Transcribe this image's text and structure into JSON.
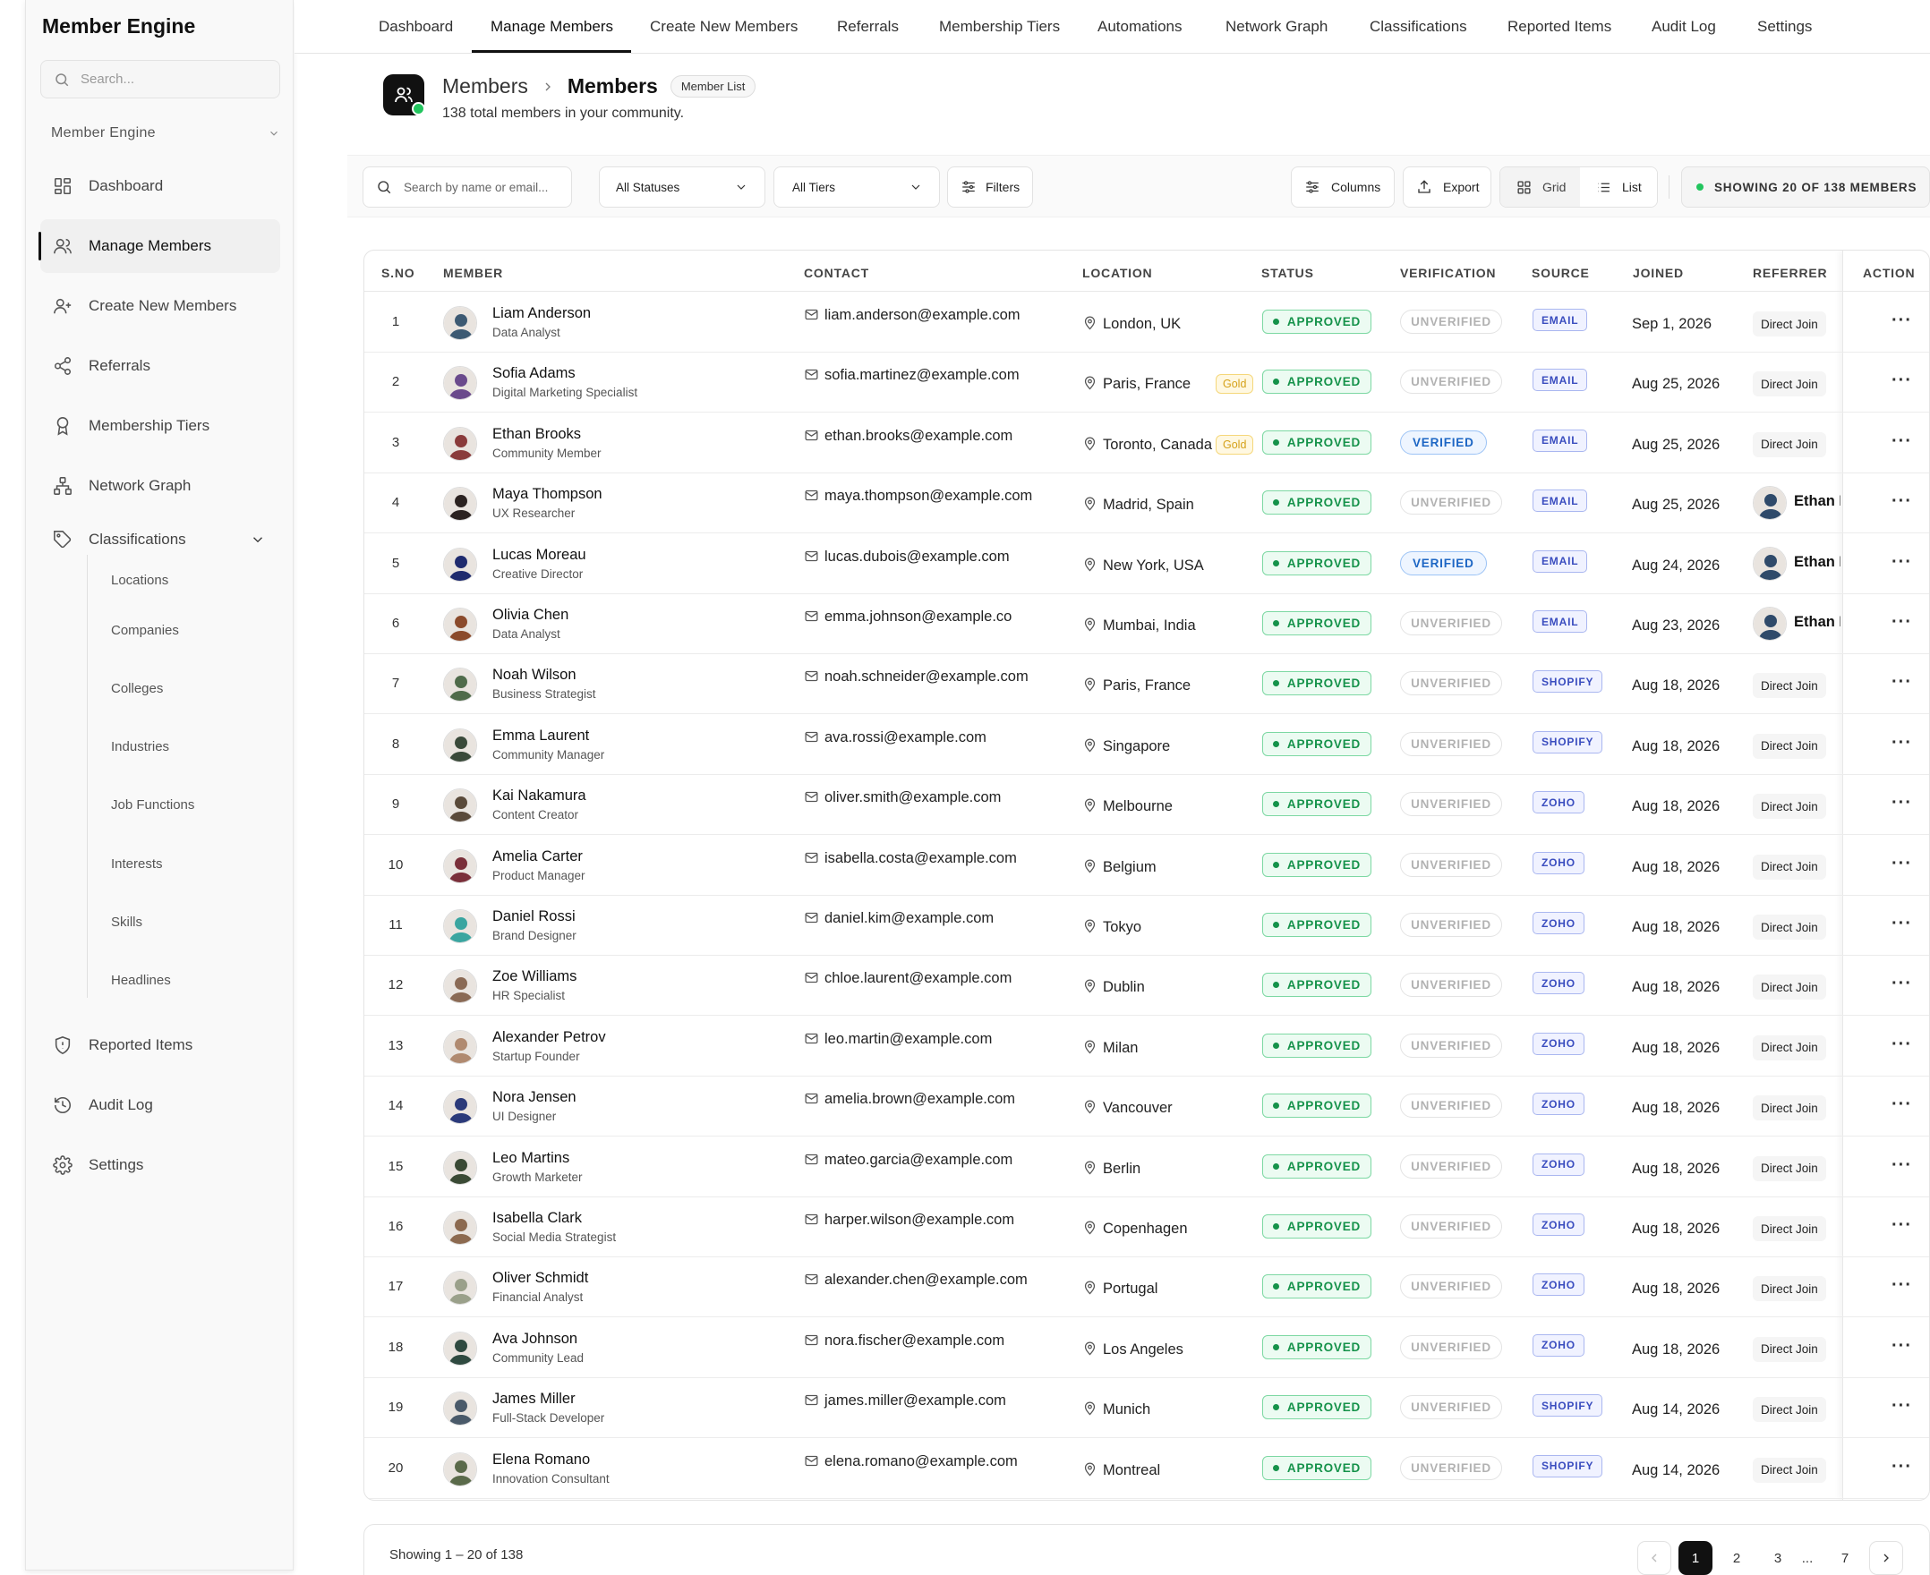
{
  "sidebar": {
    "brand": "Member Engine",
    "search_placeholder": "Search...",
    "workspace": "Member Engine",
    "items": [
      {
        "label": "Dashboard"
      },
      {
        "label": "Manage Members"
      },
      {
        "label": "Create New Members"
      },
      {
        "label": "Referrals"
      },
      {
        "label": "Membership Tiers"
      },
      {
        "label": "Network Graph"
      },
      {
        "label": "Classifications"
      },
      {
        "label": "Reported Items"
      },
      {
        "label": "Audit Log"
      },
      {
        "label": "Settings"
      }
    ],
    "subitems": [
      "Locations",
      "Companies",
      "Colleges",
      "Industries",
      "Job Functions",
      "Interests",
      "Skills",
      "Headlines"
    ]
  },
  "topnav": {
    "tabs": [
      "Dashboard",
      "Manage Members",
      "Create New Members",
      "Referrals",
      "Membership Tiers",
      "Automations",
      "Network Graph",
      "Classifications",
      "Reported Items",
      "Audit Log",
      "Settings"
    ],
    "active": "Manage Members"
  },
  "page": {
    "crumb_parent": "Members",
    "crumb_current": "Members",
    "badge": "Member List",
    "subtitle": "138 total members in your community."
  },
  "toolbar": {
    "search_placeholder": "Search by name or email...",
    "status_filter": "All Statuses",
    "tier_filter": "All Tiers",
    "filters": "Filters",
    "columns": "Columns",
    "export": "Export",
    "grid": "Grid",
    "list": "List",
    "count": "SHOWING 20 OF 138 MEMBERS"
  },
  "table": {
    "headers": [
      "S.NO",
      "MEMBER",
      "CONTACT",
      "LOCATION",
      "STATUS",
      "VERIFICATION",
      "SOURCE",
      "JOINED",
      "REFERRER",
      "ACTION"
    ],
    "rows": [
      {
        "sno": "1",
        "name": "Liam Anderson",
        "role": "Data Analyst",
        "email": "liam.anderson@example.com",
        "location": "London, UK",
        "tier": "",
        "status": "APPROVED",
        "verification": "UNVERIFIED",
        "source": "EMAIL",
        "joined": "Sep 1, 2026",
        "referrer": "Direct Join",
        "ref_avatar": false,
        "avatar_color": "#3d5a73"
      },
      {
        "sno": "2",
        "name": "Sofia Adams",
        "role": "Digital Marketing Specialist",
        "email": "sofia.martinez@example.com",
        "location": "Paris, France",
        "tier": "Gold",
        "status": "APPROVED",
        "verification": "UNVERIFIED",
        "source": "EMAIL",
        "joined": "Aug 25, 2026",
        "referrer": "Direct Join",
        "ref_avatar": false,
        "avatar_color": "#6a4a8c"
      },
      {
        "sno": "3",
        "name": "Ethan Brooks",
        "role": "Community Member",
        "email": "ethan.brooks@example.com",
        "location": "Toronto, Canada",
        "tier": "Gold",
        "status": "APPROVED",
        "verification": "VERIFIED",
        "source": "EMAIL",
        "joined": "Aug 25, 2026",
        "referrer": "Direct Join",
        "ref_avatar": false,
        "avatar_color": "#8a3b3b"
      },
      {
        "sno": "4",
        "name": "Maya Thompson",
        "role": "UX Researcher",
        "email": "maya.thompson@example.com",
        "location": "Madrid, Spain",
        "tier": "",
        "status": "APPROVED",
        "verification": "UNVERIFIED",
        "source": "EMAIL",
        "joined": "Aug 25, 2026",
        "referrer": "Ethan Brooks",
        "ref_avatar": true,
        "avatar_color": "#2b2220"
      },
      {
        "sno": "5",
        "name": "Lucas Moreau",
        "role": "Creative Director",
        "email": "lucas.dubois@example.com",
        "location": "New York, USA",
        "tier": "",
        "status": "APPROVED",
        "verification": "VERIFIED",
        "source": "EMAIL",
        "joined": "Aug 24, 2026",
        "referrer": "Ethan Brooks",
        "ref_avatar": true,
        "avatar_color": "#1f2b6e"
      },
      {
        "sno": "6",
        "name": "Olivia Chen",
        "role": "Data Analyst",
        "email": "emma.johnson@example.co",
        "location": "Mumbai, India",
        "tier": "",
        "status": "APPROVED",
        "verification": "UNVERIFIED",
        "source": "EMAIL",
        "joined": "Aug 23, 2026",
        "referrer": "Ethan Brooks",
        "ref_avatar": true,
        "avatar_color": "#8b4a2b"
      },
      {
        "sno": "7",
        "name": "Noah Wilson",
        "role": "Business Strategist",
        "email": "noah.schneider@example.com",
        "location": "Paris, France",
        "tier": "",
        "status": "APPROVED",
        "verification": "UNVERIFIED",
        "source": "SHOPIFY",
        "joined": "Aug 18, 2026",
        "referrer": "Direct Join",
        "ref_avatar": false,
        "avatar_color": "#4f6b4a"
      },
      {
        "sno": "8",
        "name": "Emma Laurent",
        "role": "Community Manager",
        "email": "ava.rossi@example.com",
        "location": "Singapore",
        "tier": "",
        "status": "APPROVED",
        "verification": "UNVERIFIED",
        "source": "SHOPIFY",
        "joined": "Aug 18, 2026",
        "referrer": "Direct Join",
        "ref_avatar": false,
        "avatar_color": "#3a4a3a"
      },
      {
        "sno": "9",
        "name": "Kai Nakamura",
        "role": "Content Creator",
        "email": "oliver.smith@example.com",
        "location": "Melbourne",
        "tier": "",
        "status": "APPROVED",
        "verification": "UNVERIFIED",
        "source": "ZOHO",
        "joined": "Aug 18, 2026",
        "referrer": "Direct Join",
        "ref_avatar": false,
        "avatar_color": "#5a4a3a"
      },
      {
        "sno": "10",
        "name": "Amelia Carter",
        "role": "Product Manager",
        "email": "isabella.costa@example.com",
        "location": "Belgium",
        "tier": "",
        "status": "APPROVED",
        "verification": "UNVERIFIED",
        "source": "ZOHO",
        "joined": "Aug 18, 2026",
        "referrer": "Direct Join",
        "ref_avatar": false,
        "avatar_color": "#7a2f3a"
      },
      {
        "sno": "11",
        "name": "Daniel Rossi",
        "role": "Brand Designer",
        "email": "daniel.kim@example.com",
        "location": "Tokyo",
        "tier": "",
        "status": "APPROVED",
        "verification": "UNVERIFIED",
        "source": "ZOHO",
        "joined": "Aug 18, 2026",
        "referrer": "Direct Join",
        "ref_avatar": false,
        "avatar_color": "#3aa5a0"
      },
      {
        "sno": "12",
        "name": "Zoe Williams",
        "role": "HR Specialist",
        "email": "chloe.laurent@example.com",
        "location": "Dublin",
        "tier": "",
        "status": "APPROVED",
        "verification": "UNVERIFIED",
        "source": "ZOHO",
        "joined": "Aug 18, 2026",
        "referrer": "Direct Join",
        "ref_avatar": false,
        "avatar_color": "#8a6a55"
      },
      {
        "sno": "13",
        "name": "Alexander Petrov",
        "role": "Startup Founder",
        "email": "leo.martin@example.com",
        "location": "Milan",
        "tier": "",
        "status": "APPROVED",
        "verification": "UNVERIFIED",
        "source": "ZOHO",
        "joined": "Aug 18, 2026",
        "referrer": "Direct Join",
        "ref_avatar": false,
        "avatar_color": "#b08a70"
      },
      {
        "sno": "14",
        "name": "Nora Jensen",
        "role": "UI Designer",
        "email": "amelia.brown@example.com",
        "location": "Vancouver",
        "tier": "",
        "status": "APPROVED",
        "verification": "UNVERIFIED",
        "source": "ZOHO",
        "joined": "Aug 18, 2026",
        "referrer": "Direct Join",
        "ref_avatar": false,
        "avatar_color": "#2b3a7a"
      },
      {
        "sno": "15",
        "name": "Leo Martins",
        "role": "Growth Marketer",
        "email": "mateo.garcia@example.com",
        "location": "Berlin",
        "tier": "",
        "status": "APPROVED",
        "verification": "UNVERIFIED",
        "source": "ZOHO",
        "joined": "Aug 18, 2026",
        "referrer": "Direct Join",
        "ref_avatar": false,
        "avatar_color": "#3a4a35"
      },
      {
        "sno": "16",
        "name": "Isabella Clark",
        "role": "Social Media Strategist",
        "email": "harper.wilson@example.com",
        "location": "Copenhagen",
        "tier": "",
        "status": "APPROVED",
        "verification": "UNVERIFIED",
        "source": "ZOHO",
        "joined": "Aug 18, 2026",
        "referrer": "Direct Join",
        "ref_avatar": false,
        "avatar_color": "#8c6a50"
      },
      {
        "sno": "17",
        "name": "Oliver Schmidt",
        "role": "Financial Analyst",
        "email": "alexander.chen@example.com",
        "location": "Portugal",
        "tier": "",
        "status": "APPROVED",
        "verification": "UNVERIFIED",
        "source": "ZOHO",
        "joined": "Aug 18, 2026",
        "referrer": "Direct Join",
        "ref_avatar": false,
        "avatar_color": "#9aa08a"
      },
      {
        "sno": "18",
        "name": "Ava Johnson",
        "role": "Community Lead",
        "email": "nora.fischer@example.com",
        "location": "Los Angeles",
        "tier": "",
        "status": "APPROVED",
        "verification": "UNVERIFIED",
        "source": "ZOHO",
        "joined": "Aug 18, 2026",
        "referrer": "Direct Join",
        "ref_avatar": false,
        "avatar_color": "#2f4a40"
      },
      {
        "sno": "19",
        "name": "James Miller",
        "role": "Full-Stack Developer",
        "email": "james.miller@example.com",
        "location": "Munich",
        "tier": "",
        "status": "APPROVED",
        "verification": "UNVERIFIED",
        "source": "SHOPIFY",
        "joined": "Aug 14, 2026",
        "referrer": "Direct Join",
        "ref_avatar": false,
        "avatar_color": "#4a5a6a"
      },
      {
        "sno": "20",
        "name": "Elena Romano",
        "role": "Innovation Consultant",
        "email": "elena.romano@example.com",
        "location": "Montreal",
        "tier": "",
        "status": "APPROVED",
        "verification": "UNVERIFIED",
        "source": "SHOPIFY",
        "joined": "Aug 14, 2026",
        "referrer": "Direct Join",
        "ref_avatar": false,
        "avatar_color": "#5a6a4a"
      }
    ]
  },
  "footer": {
    "showing": "Showing 1 – 20 of 138",
    "pages": [
      "1",
      "2",
      "3",
      "...",
      "7"
    ],
    "current_page": "1"
  }
}
